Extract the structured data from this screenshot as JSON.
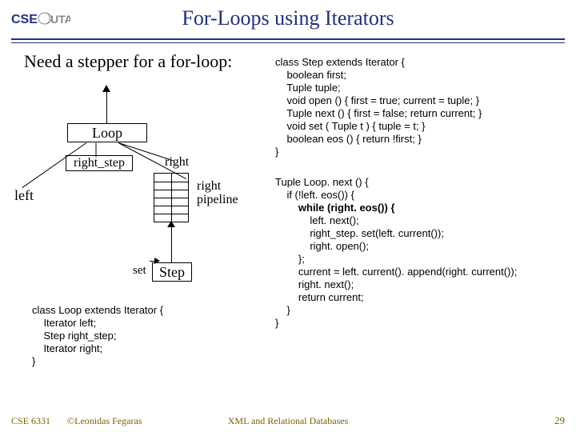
{
  "logo": {
    "left": "CSE",
    "right": "UTA"
  },
  "title": "For-Loops using Iterators",
  "subtitle": "Need a stepper for a for-loop:",
  "diagram": {
    "loop": "Loop",
    "right_step": "right_step",
    "right": "right",
    "left": "left",
    "right_pipeline": "right\npipeline",
    "step": "Step",
    "set": "set"
  },
  "code_step": "class Step extends Iterator {\n    boolean first;\n    Tuple tuple;\n    void open () { first = true; current = tuple; }\n    Tuple next () { first = false; return current; }\n    void set ( Tuple t ) { tuple = t; }\n    boolean eos () { return !first; }\n}",
  "code_loop_next": "Tuple Loop. next () {\n    if (!left. eos()) {\n        while (right. eos()) {\n            left. next();\n            right_step. set(left. current());\n            right. open();\n        };\n        current = left. current(). append(right. current());\n        right. next();\n        return current;\n    }\n}",
  "code_loop_ext": "class Loop extends Iterator {\n    Iterator left;\n    Step right_step;\n    Iterator right;\n}",
  "footer": {
    "course": "CSE 6331",
    "copyright": "©Leonidas Fegaras",
    "center": "XML and Relational Databases",
    "page": "29"
  }
}
